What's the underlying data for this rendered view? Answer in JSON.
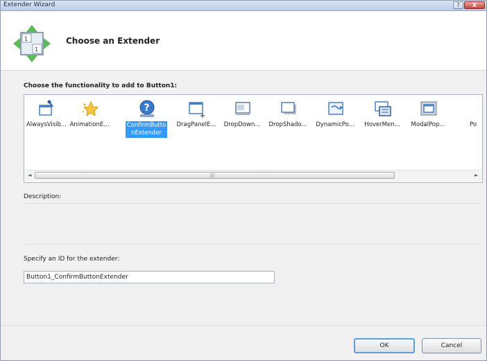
{
  "window": {
    "title": "Extender Wizard",
    "help_glyph": "?",
    "close_glyph": "X"
  },
  "header": {
    "title": "Choose an Extender",
    "icon": "extender-wizard-icon"
  },
  "extender_list": {
    "label": "Choose the functionality to add to Button1:",
    "selected_index": 2,
    "items": [
      {
        "label": "AlwaysVisib...",
        "icon": "pushpin-window-icon"
      },
      {
        "label": "AnimationE...",
        "icon": "star-sparkle-icon"
      },
      {
        "label": "ConfirmButtonExtender",
        "icon": "question-icon"
      },
      {
        "label": "DragPanelE...",
        "icon": "drag-panel-icon"
      },
      {
        "label": "DropDown...",
        "icon": "dropdown-window-icon"
      },
      {
        "label": "DropShado...",
        "icon": "drop-shadow-icon"
      },
      {
        "label": "DynamicPo...",
        "icon": "dynamic-populate-icon"
      },
      {
        "label": "HoverMen...",
        "icon": "hover-menu-icon"
      },
      {
        "label": "ModalPop...",
        "icon": "modal-popup-icon"
      },
      {
        "label": "Po",
        "icon": "popup-icon"
      }
    ],
    "scroll_left": "◄",
    "scroll_right": "►",
    "scroll_grip": "|||"
  },
  "description": {
    "label": "Description:",
    "text": ""
  },
  "id_field": {
    "label": "Specify an ID for the extender:",
    "value": "Button1_ConfirmButtonExtender"
  },
  "buttons": {
    "ok": "OK",
    "cancel": "Cancel"
  },
  "colors": {
    "selection": "#3399ff",
    "accent_border": "#57a0e0"
  }
}
